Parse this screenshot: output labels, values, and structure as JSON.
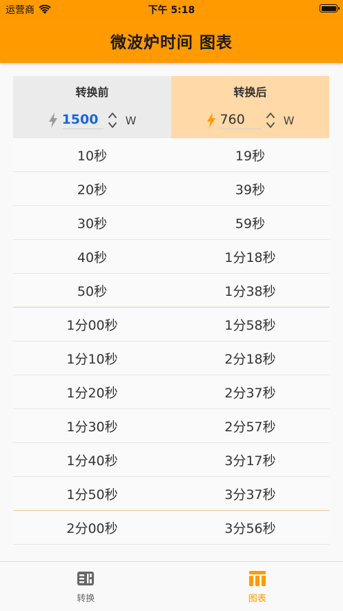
{
  "status_bar": {
    "carrier": "运营商",
    "time": "下午 5:18"
  },
  "nav": {
    "title": "微波炉时间 图表"
  },
  "header": {
    "before_label": "转换前",
    "after_label": "转换后",
    "before_power": "1500",
    "after_power": "760",
    "unit": "W"
  },
  "rows": [
    {
      "before": "10秒",
      "after": "19秒"
    },
    {
      "before": "20秒",
      "after": "39秒"
    },
    {
      "before": "30秒",
      "after": "59秒"
    },
    {
      "before": "40秒",
      "after": "1分18秒"
    },
    {
      "before": "50秒",
      "after": "1分38秒"
    },
    {
      "before": "1分00秒",
      "after": "1分58秒"
    },
    {
      "before": "1分10秒",
      "after": "2分18秒"
    },
    {
      "before": "1分20秒",
      "after": "2分37秒"
    },
    {
      "before": "1分30秒",
      "after": "2分57秒"
    },
    {
      "before": "1分40秒",
      "after": "3分17秒"
    },
    {
      "before": "1分50秒",
      "after": "3分37秒"
    },
    {
      "before": "2分00秒",
      "after": "3分56秒"
    }
  ],
  "tabs": [
    {
      "label": "转换",
      "icon": "converter-icon",
      "active": false
    },
    {
      "label": "图表",
      "icon": "chart-table-icon",
      "active": true
    }
  ],
  "colors": {
    "accent": "#ff9a00",
    "before_header_bg": "#ebebeb",
    "after_header_bg": "#ffd9a8",
    "input_blue": "#1a66e0",
    "bolt_gray": "#9a9a9a",
    "bolt_orange": "#ff9a00"
  }
}
